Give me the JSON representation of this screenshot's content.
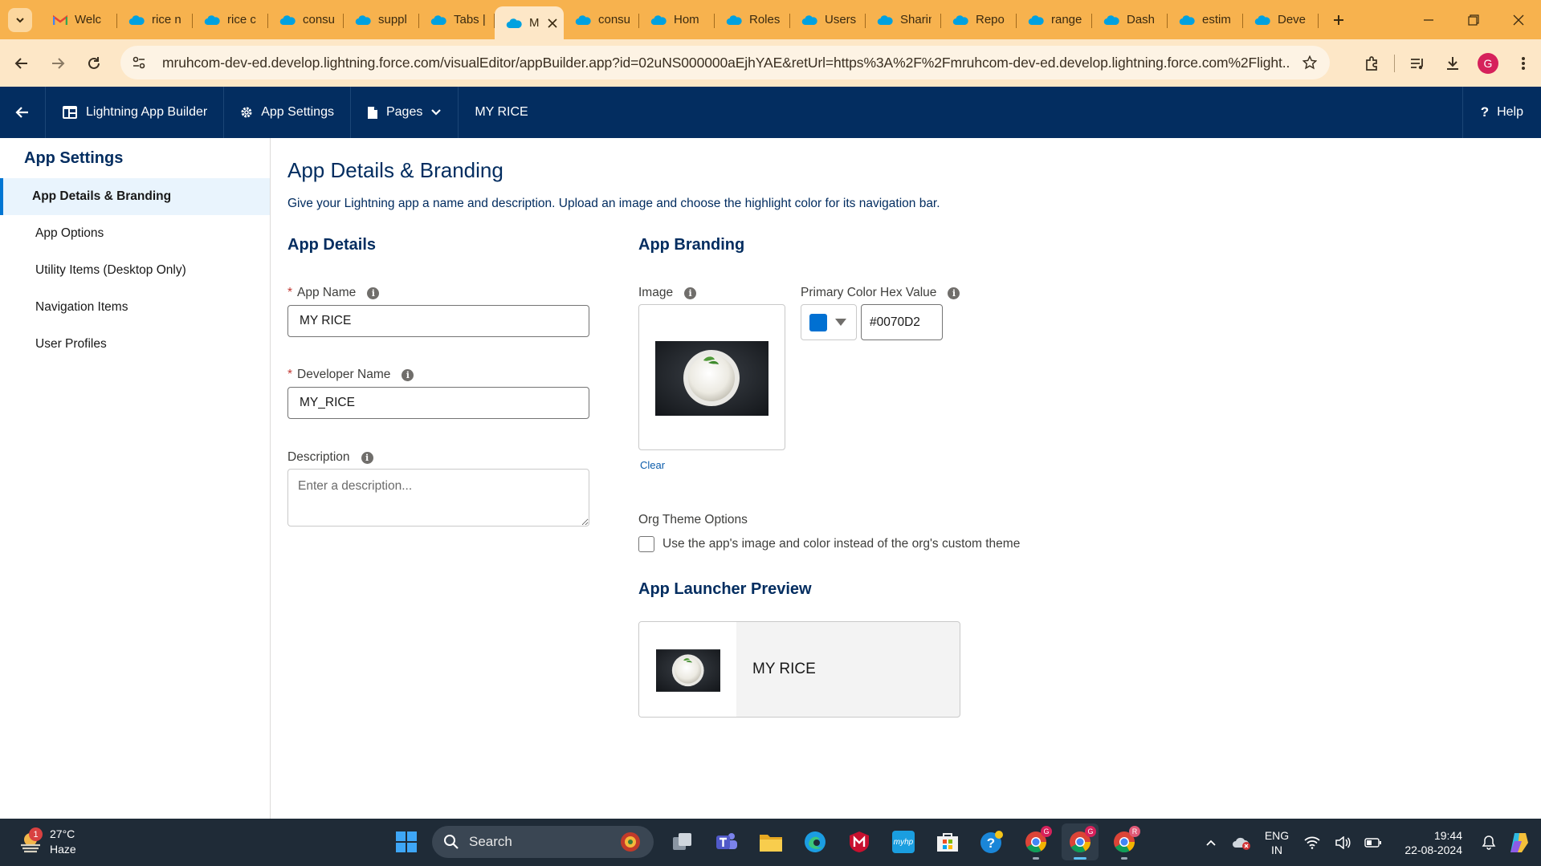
{
  "browser": {
    "tabs": [
      {
        "title": "Welc",
        "icon": "gmail-icon"
      },
      {
        "title": "rice n",
        "icon": "salesforce-cloud-icon"
      },
      {
        "title": "rice c",
        "icon": "salesforce-cloud-icon"
      },
      {
        "title": "consu",
        "icon": "salesforce-cloud-icon"
      },
      {
        "title": "suppl",
        "icon": "salesforce-cloud-icon"
      },
      {
        "title": "Tabs |",
        "icon": "salesforce-cloud-icon"
      },
      {
        "title": "M",
        "icon": "salesforce-cloud-icon",
        "active": true
      },
      {
        "title": "consu",
        "icon": "salesforce-cloud-icon"
      },
      {
        "title": "Hom",
        "icon": "salesforce-cloud-icon"
      },
      {
        "title": "Roles",
        "icon": "salesforce-cloud-icon"
      },
      {
        "title": "Users",
        "icon": "salesforce-cloud-icon"
      },
      {
        "title": "Sharin",
        "icon": "salesforce-cloud-icon"
      },
      {
        "title": "Repo",
        "icon": "salesforce-cloud-icon"
      },
      {
        "title": "range",
        "icon": "salesforce-cloud-icon"
      },
      {
        "title": "Dash",
        "icon": "salesforce-cloud-icon"
      },
      {
        "title": "estim",
        "icon": "salesforce-cloud-icon"
      },
      {
        "title": "Deve",
        "icon": "salesforce-cloud-icon"
      }
    ],
    "url": "mruhcom-dev-ed.develop.lightning.force.com/visualEditor/appBuilder.app?id=02uNS000000aEjhYAE&retUrl=https%3A%2F%2Fmruhcom-dev-ed.develop.lightning.force.com%2Flight...",
    "profile_initial": "G",
    "colors": {
      "tabbar": "#f7b24e",
      "toolbar": "#fde7c7"
    }
  },
  "appbuilder": {
    "items": {
      "builder": "Lightning App Builder",
      "settings": "App Settings",
      "pages": "Pages",
      "app_name": "MY RICE",
      "help": "Help"
    },
    "color": "#032d60"
  },
  "sidebar": {
    "title": "App Settings",
    "items": [
      {
        "label": "App Details & Branding",
        "active": true
      },
      {
        "label": "App Options"
      },
      {
        "label": "Utility Items (Desktop Only)"
      },
      {
        "label": "Navigation Items"
      },
      {
        "label": "User Profiles"
      }
    ]
  },
  "main": {
    "title": "App Details & Branding",
    "description": "Give your Lightning app a name and description. Upload an image and choose the highlight color for its navigation bar.",
    "details": {
      "heading": "App Details",
      "app_name_label": "App Name",
      "app_name_value": "MY RICE",
      "dev_name_label": "Developer Name",
      "dev_name_value": "MY_RICE",
      "description_label": "Description",
      "description_placeholder": "Enter a description..."
    },
    "branding": {
      "heading": "App Branding",
      "image_label": "Image",
      "clear_link": "Clear",
      "primary_color_label": "Primary Color Hex Value",
      "primary_color_value": "#0070D2",
      "swatch_color": "#0070d2",
      "org_theme_label": "Org Theme Options",
      "org_theme_checkbox": "Use the app's image and color instead of the org's custom theme",
      "org_theme_checked": false
    },
    "preview": {
      "heading": "App Launcher Preview",
      "app_name": "MY RICE"
    }
  },
  "taskbar": {
    "weather": {
      "temp": "27°C",
      "condition": "Haze",
      "badge": "1"
    },
    "search_placeholder": "Search",
    "apps": [
      "windows-start-icon",
      "task-view-icon",
      "teams-icon",
      "file-explorer-icon",
      "edge-icon",
      "mcafee-icon",
      "myhp-icon",
      "microsoft-store-icon",
      "help-icon",
      "chrome-icon",
      "chrome-icon",
      "chrome-icon"
    ],
    "chrome_badges": [
      "G",
      "G",
      "R"
    ],
    "lang": {
      "line1": "ENG",
      "line2": "IN"
    },
    "time": "19:44",
    "date": "22-08-2024",
    "myhp_label": "myhp"
  }
}
